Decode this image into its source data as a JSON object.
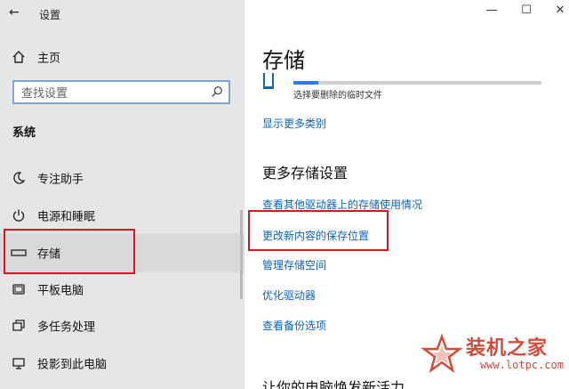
{
  "window": {
    "title": "设置",
    "back_icon": "back-arrow-icon"
  },
  "sidebar": {
    "home_label": "主页",
    "search": {
      "placeholder": "查找设置"
    },
    "section_title": "系统",
    "items": [
      {
        "label": "专注助手",
        "icon": "moon-icon"
      },
      {
        "label": "电源和睡眠",
        "icon": "power-icon"
      },
      {
        "label": "存储",
        "icon": "storage-icon",
        "selected": true
      },
      {
        "label": "平板电脑",
        "icon": "tablet-icon"
      },
      {
        "label": "多任务处理",
        "icon": "multitask-icon"
      },
      {
        "label": "投影到此电脑",
        "icon": "project-icon"
      }
    ]
  },
  "main": {
    "page_title": "存储",
    "temp_files": {
      "label": "选择要删除的临时文件",
      "progress": 0.1
    },
    "show_more_link": "显示更多类别",
    "more_settings": {
      "heading": "更多存储设置",
      "links": [
        "查看其他驱动器上的存储使用情况",
        "更改新内容的保存位置",
        "管理存储空间",
        "优化驱动器",
        "查看备份选项"
      ]
    },
    "bottom_heading": "让你的电脑焕发新活力"
  },
  "window_controls": {
    "minimize": "—",
    "maximize": "☐",
    "close": "✕"
  },
  "watermark": {
    "title": "装机之家",
    "url": "www.lotpc.com"
  },
  "colors": {
    "accent": "#0a63c8",
    "highlight": "#e0141e",
    "sidebar_bg": "#e6e6e6"
  }
}
